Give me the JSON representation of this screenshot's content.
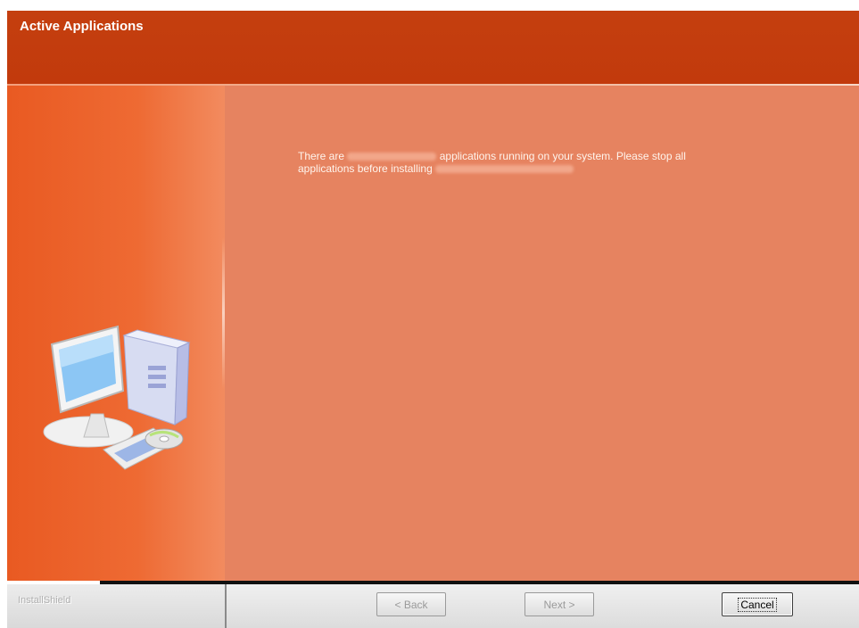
{
  "window": {
    "title": "Active Applications"
  },
  "message": {
    "part1": "There are",
    "part2": "applications running on your system. Please stop all",
    "part3": "applications before installing"
  },
  "footer": {
    "brand": "InstallShield",
    "back_label": "< Back",
    "next_label": "Next >",
    "cancel_label": "Cancel"
  },
  "icons": {
    "illustration": "computer-setup-icon"
  },
  "colors": {
    "header": "#c43f0f",
    "sidepanel": "#ee6a33",
    "content": "#e68360"
  }
}
